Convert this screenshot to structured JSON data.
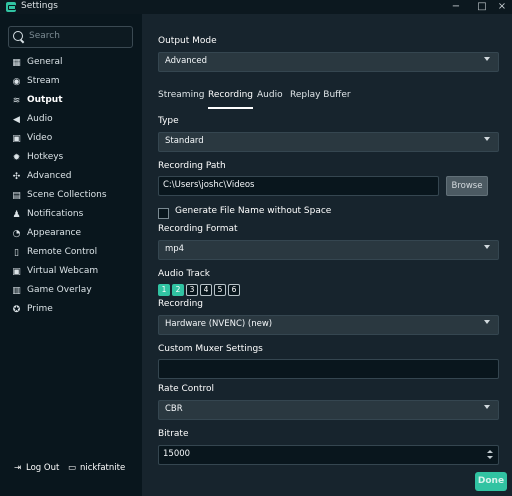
{
  "window": {
    "title": "Settings",
    "minimize_icon": "−",
    "restore_icon": "□",
    "close_icon": "×"
  },
  "search": {
    "placeholder": "Search"
  },
  "sidebar": {
    "items": [
      {
        "label": "General",
        "icon": "grid-icon",
        "glyph": "▦"
      },
      {
        "label": "Stream",
        "icon": "globe-icon",
        "glyph": "◉"
      },
      {
        "label": "Output",
        "icon": "layers-icon",
        "glyph": "≋"
      },
      {
        "label": "Audio",
        "icon": "speaker-icon",
        "glyph": "◀"
      },
      {
        "label": "Video",
        "icon": "video-camera-icon",
        "glyph": "▣"
      },
      {
        "label": "Hotkeys",
        "icon": "gear-icon",
        "glyph": "✹"
      },
      {
        "label": "Advanced",
        "icon": "cogs-icon",
        "glyph": "✣"
      },
      {
        "label": "Scene Collections",
        "icon": "collections-icon",
        "glyph": "▤"
      },
      {
        "label": "Notifications",
        "icon": "bell-icon",
        "glyph": "♟"
      },
      {
        "label": "Appearance",
        "icon": "palette-icon",
        "glyph": "◔"
      },
      {
        "label": "Remote Control",
        "icon": "remote-icon",
        "glyph": "▯"
      },
      {
        "label": "Virtual Webcam",
        "icon": "webcam-icon",
        "glyph": "▣"
      },
      {
        "label": "Game Overlay",
        "icon": "overlay-icon",
        "glyph": "▥"
      },
      {
        "label": "Prime",
        "icon": "prime-icon",
        "glyph": "✪"
      }
    ],
    "logout_label": "Log Out",
    "username": "nickfatnite"
  },
  "main": {
    "output_mode_label": "Output Mode",
    "output_mode_value": "Advanced",
    "tabs": [
      "Streaming",
      "Recording",
      "Audio",
      "Replay Buffer"
    ],
    "type_label": "Type",
    "type_value": "Standard",
    "recording_path_label": "Recording Path",
    "recording_path_value": "C:\\Users\\joshc\\Videos",
    "browse_label": "Browse",
    "generate_file_label": "Generate File Name without Space",
    "recording_format_label": "Recording Format",
    "recording_format_value": "mp4",
    "audio_track_label": "Audio Track",
    "tracks": [
      "1",
      "2",
      "3",
      "4",
      "5",
      "6"
    ],
    "recording_label": "Recording",
    "recording_value": "Hardware (NVENC) (new)",
    "custom_muxer_label": "Custom Muxer Settings",
    "custom_muxer_value": "",
    "rate_control_label": "Rate Control",
    "rate_control_value": "CBR",
    "bitrate_label": "Bitrate",
    "bitrate_value": "15000",
    "done_label": "Done"
  }
}
